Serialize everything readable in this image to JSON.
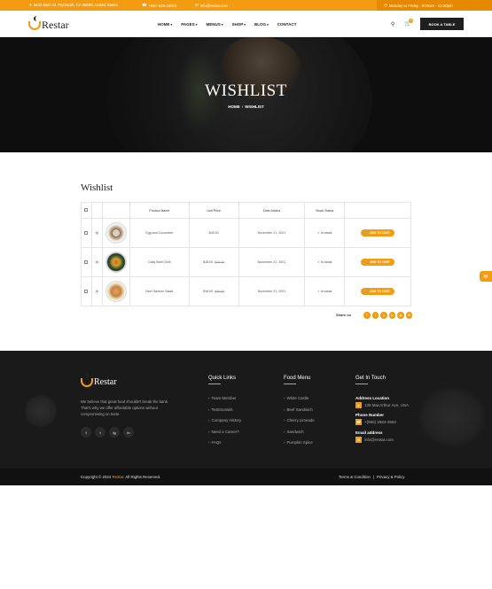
{
  "topbar": {
    "address": "9402 Main St. Plymouth, CA 95669, United States",
    "phone": "+567-629-18015",
    "email": "info@restar.com",
    "hours": "Monday to Friday : 9:00am - 22:00pm"
  },
  "nav": {
    "brand": "Restar",
    "menu": [
      {
        "label": "HOME",
        "dropdown": true
      },
      {
        "label": "PAGES",
        "dropdown": true
      },
      {
        "label": "MENUS",
        "dropdown": true
      },
      {
        "label": "SHOP",
        "dropdown": true
      },
      {
        "label": "BLOG",
        "dropdown": true
      },
      {
        "label": "CONTACT",
        "dropdown": false
      }
    ],
    "cart_count": "0",
    "book_label": "BOOK A TABLE"
  },
  "hero": {
    "title": "WISHLIST",
    "breadcrumb_home": "HOME",
    "breadcrumb_current": "WISHLIST"
  },
  "wishlist": {
    "heading": "Wishlist",
    "columns": [
      "Product Name",
      "Unit Price",
      "Date Added",
      "Stock Status"
    ],
    "rows": [
      {
        "name": "Egg and Cucumber",
        "price": "$45.00",
        "old_price": "",
        "date": "November 21, 2021",
        "stock": "In stock",
        "action": "ADD TO CART",
        "image": "egg-cucumber-dish"
      },
      {
        "name": "Daily Beef Chilli",
        "price": "$18.00",
        "old_price": "$29.00",
        "date": "November 21, 2021",
        "stock": "In stock",
        "action": "ADD TO CART",
        "image": "beef-chilli-dish"
      },
      {
        "name": "Beer Salmon Salad",
        "price": "$18.00",
        "old_price": "$39.00",
        "date": "November 21, 2021",
        "stock": "In stock",
        "action": "ADD TO CART",
        "image": "salmon-salad-dish"
      }
    ],
    "share_label": "Share on",
    "share_icons": [
      "facebook-icon",
      "twitter-icon",
      "pinterest-icon",
      "linkedin-icon",
      "instagram-icon",
      "email-icon"
    ]
  },
  "footer": {
    "brand": "Restar",
    "description": "We believe that great food shouldn't break the bank. That's why we offer affordable options without compromising on taste.",
    "social": [
      "f",
      "t",
      "in",
      "ig"
    ],
    "quick_links_title": "Quick Links",
    "quick_links": [
      "Team Member",
      "Testimonials",
      "Company History",
      "Need a Career?",
      "FAQs"
    ],
    "food_menu_title": "Food Menu",
    "food_menu": [
      "White Castle",
      "Beef Sandwich",
      "Cherry Limeade",
      "Sandwich",
      "Pumpkin Spice"
    ],
    "contact_title": "Get In Touch",
    "address_label": "Address Location",
    "address_value": "138 MacArthur Ave, USA",
    "phone_label": "Phone Number",
    "phone_value": "+(965) 2554-3554",
    "email_label": "Email address",
    "email_value": "info@restar.com"
  },
  "bottom": {
    "copy_prefix": "Copyright © 2024",
    "copy_brand": "Restar",
    "copy_suffix": ". All Rights Reserved.",
    "terms": "Terms & Condition",
    "privacy": "Privacy & Policy"
  },
  "colors": {
    "accent": "#f39c12",
    "dark": "#1a1a1a"
  }
}
